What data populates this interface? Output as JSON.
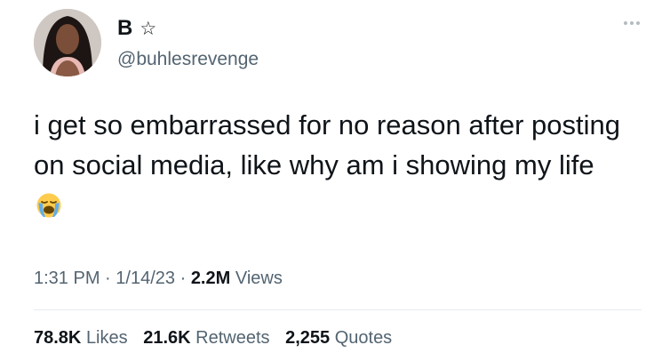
{
  "user": {
    "display_name": "B",
    "name_icon": "star-outline-icon",
    "handle": "@buhlesrevenge"
  },
  "tweet": {
    "text": "i get so embarrassed for no reason after posting on social media, like why am i showing my life",
    "emoji": "loudly-crying-face-icon"
  },
  "meta": {
    "time": "1:31 PM",
    "separator": "·",
    "date": "1/14/23",
    "views_count": "2.2M",
    "views_label": "Views"
  },
  "stats": {
    "likes_count": "78.8K",
    "likes_label": "Likes",
    "retweets_count": "21.6K",
    "retweets_label": "Retweets",
    "quotes_count": "2,255",
    "quotes_label": "Quotes"
  },
  "colors": {
    "primary_text": "#0f1419",
    "secondary_text": "#536471",
    "divider": "#e6ecf0"
  }
}
